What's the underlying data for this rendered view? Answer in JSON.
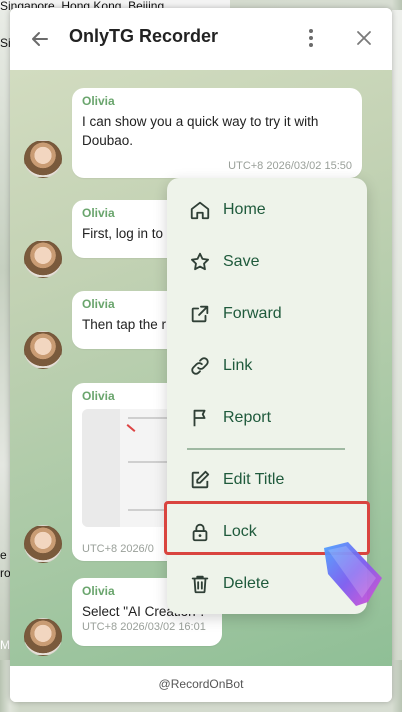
{
  "background": {
    "top_fragment": "Singapore, Hong Kong, Beijing",
    "left_fragments": [
      "Si",
      "e",
      "ro",
      "M"
    ]
  },
  "titlebar": {
    "title": "OnlyTG Recorder",
    "back_icon": "arrow-left-icon",
    "more_icon": "more-vertical-icon",
    "close_icon": "close-icon"
  },
  "messages": [
    {
      "sender": "Olivia",
      "text": "I can show you a quick way to try it with Doubao.",
      "time": "UTC+8 2026/03/02 15:50"
    },
    {
      "sender": "Olivia",
      "text": "First, log in to",
      "time": ""
    },
    {
      "sender": "Olivia",
      "text": "Then tap the r",
      "time": ""
    },
    {
      "sender": "Olivia",
      "text": "",
      "time": "UTC+8 2026/0",
      "image": true
    },
    {
      "sender": "Olivia",
      "text": "Select \"AI Creation\".",
      "time": "UTC+8 2026/03/02 16:01"
    }
  ],
  "menu": {
    "items": [
      {
        "label": "Home",
        "icon": "home-icon"
      },
      {
        "label": "Save",
        "icon": "star-icon"
      },
      {
        "label": "Forward",
        "icon": "share-icon"
      },
      {
        "label": "Link",
        "icon": "link-icon"
      },
      {
        "label": "Report",
        "icon": "flag-icon"
      },
      {
        "label": "Edit Title",
        "icon": "edit-icon"
      },
      {
        "label": "Lock",
        "icon": "lock-icon"
      },
      {
        "label": "Delete",
        "icon": "trash-icon"
      }
    ]
  },
  "footer": {
    "text": "@RecordOnBot"
  },
  "colors": {
    "accent": "#6aa56d",
    "menu_text": "#1f5a3c",
    "menu_bg": "#eef3ea",
    "highlight": "#d9443f"
  }
}
